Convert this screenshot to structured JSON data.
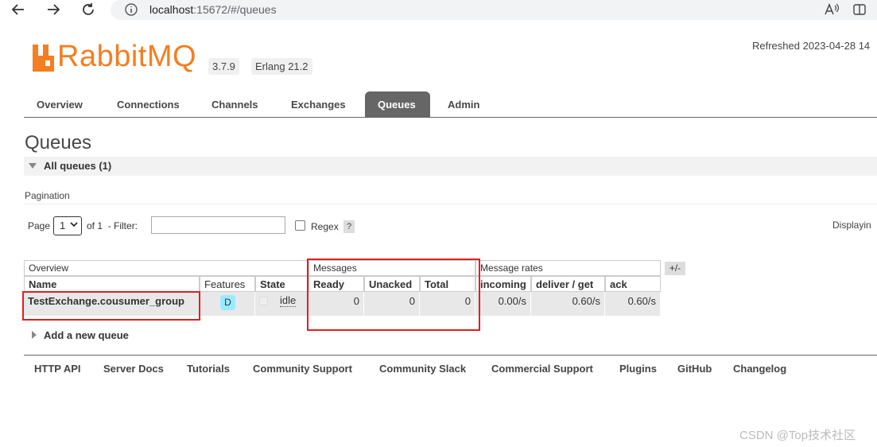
{
  "browser": {
    "url_host": "localhost",
    "url_path": ":15672/#/queues"
  },
  "header": {
    "logo_text": "RabbitMQ",
    "version": "3.7.9",
    "erlang": "Erlang 21.2",
    "refreshed": "Refreshed 2023-04-28 14"
  },
  "tabs": [
    "Overview",
    "Connections",
    "Channels",
    "Exchanges",
    "Queues",
    "Admin"
  ],
  "active_tab": "Queues",
  "page": {
    "title": "Queues",
    "section_title": "All queues (1)",
    "pagination_label": "Pagination",
    "page_label": "Page",
    "page_value": "1",
    "of_label": "of 1",
    "filter_label": "- Filter:",
    "filter_value": "",
    "regex_label": "Regex",
    "help_label": "?",
    "displaying": "Displayin"
  },
  "table": {
    "groups": [
      "Overview",
      "Messages",
      "Message rates"
    ],
    "plus_minus": "+/-",
    "columns": [
      "Name",
      "Features",
      "State",
      "Ready",
      "Unacked",
      "Total",
      "incoming",
      "deliver / get",
      "ack"
    ],
    "rows": [
      {
        "name": "TestExchange.cousumer_group",
        "feature": "D",
        "state": "idle",
        "ready": "0",
        "unacked": "0",
        "total": "0",
        "incoming": "0.00/s",
        "deliver_get": "0.60/s",
        "ack": "0.60/s"
      }
    ]
  },
  "add_queue": "Add a new queue",
  "footer_links": [
    "HTTP API",
    "Server Docs",
    "Tutorials",
    "Community Support",
    "Community Slack",
    "Commercial Support",
    "Plugins",
    "GitHub",
    "Changelog"
  ],
  "watermark": "CSDN @Top技术社区",
  "colors": {
    "brand": "#f47e20",
    "active_tab": "#666666",
    "annotation": "#e02020",
    "feature_badge": "#99ebff"
  }
}
